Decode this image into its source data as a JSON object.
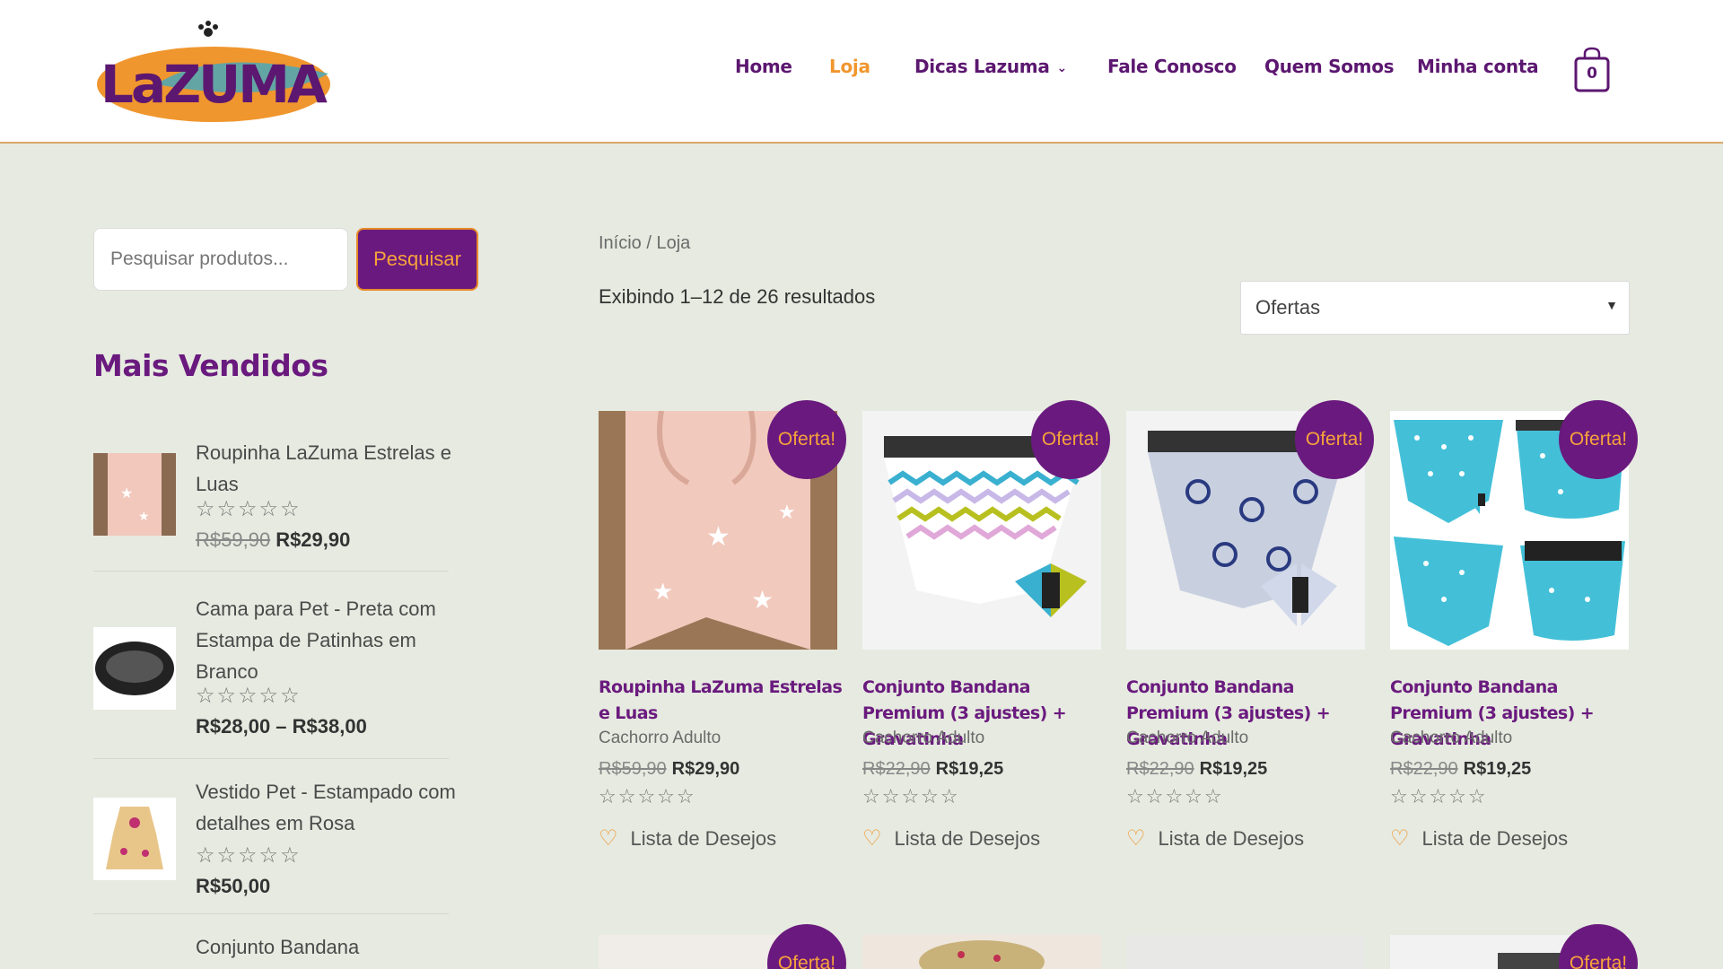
{
  "colors": {
    "brand_purple": "#6a1a7e",
    "brand_orange": "#f0962e",
    "background": "#e6eae0"
  },
  "header": {
    "logo_text": "LaZUMA",
    "nav": [
      {
        "label": "Home",
        "active": false
      },
      {
        "label": "Loja",
        "active": true
      },
      {
        "label": "Dicas Lazuma",
        "active": false,
        "has_dropdown": true
      },
      {
        "label": "Fale Conosco",
        "active": false
      },
      {
        "label": "Quem Somos",
        "active": false
      },
      {
        "label": "Minha conta",
        "active": false
      }
    ],
    "cart_count": "0",
    "cart_icon": "shopping-bag-icon"
  },
  "sidebar": {
    "search": {
      "placeholder": "Pesquisar produtos...",
      "button": "Pesquisar"
    },
    "widget_title": "Mais Vendidos",
    "best_sellers": [
      {
        "name": "Roupinha LaZuma Estrelas e Luas",
        "old_price": "R$59,90",
        "price": "R$29,90",
        "rating": 0
      },
      {
        "name": "Cama para Pet - Preta com Estampa de Patinhas em Branco",
        "old_price": "",
        "price": "R$28,00 – R$38,00",
        "rating": 0
      },
      {
        "name": "Vestido Pet - Estampado com detalhes em Rosa",
        "old_price": "",
        "price": "R$50,00",
        "rating": 0
      },
      {
        "name": "Conjunto Bandana",
        "old_price": "",
        "price": "",
        "rating": 0
      }
    ]
  },
  "main": {
    "breadcrumb": "Início / Loja",
    "result_count": "Exibindo 1–12 de 26 resultados",
    "ordering": "Ofertas",
    "sale_badge": "Oferta!",
    "wishlist_label": "Lista de Desejos",
    "products": [
      {
        "title": "Roupinha LaZuma Estrelas e Luas",
        "category": "Cachorro Adulto",
        "old_price": "R$59,90",
        "price": "R$29,90",
        "rating": 0,
        "on_sale": true
      },
      {
        "title": "Conjunto Bandana Premium (3 ajustes) + Gravatinha",
        "category": "Cachorro Adulto",
        "old_price": "R$22,90",
        "price": "R$19,25",
        "rating": 0,
        "on_sale": true
      },
      {
        "title": "Conjunto Bandana Premium (3 ajustes) + Gravatinha",
        "category": "Cachorro Adulto",
        "old_price": "R$22,90",
        "price": "R$19,25",
        "rating": 0,
        "on_sale": true
      },
      {
        "title": "Conjunto Bandana Premium (3 ajustes) + Gravatinha",
        "category": "Cachorro Adulto",
        "old_price": "R$22,90",
        "price": "R$19,25",
        "rating": 0,
        "on_sale": true
      }
    ]
  }
}
